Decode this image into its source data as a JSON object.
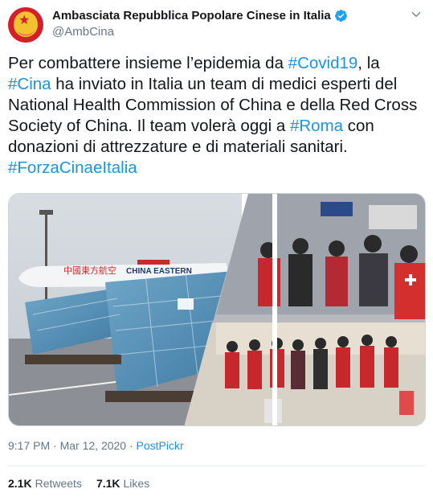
{
  "account": {
    "display_name": "Ambasciata Repubblica Popolare Cinese in Italia",
    "handle": "@AmbCina",
    "verified": true,
    "avatar_icon": "china-national-emblem"
  },
  "tweet": {
    "lines": [
      [
        {
          "t": "Per combattere insieme l’epidemia da "
        },
        {
          "t": "#Covid19",
          "tag": true
        },
        {
          "t": ", la"
        }
      ],
      [
        {
          "t": "#Cina",
          "tag": true
        },
        {
          "t": " ha inviato in Italia un team di medici esperti del"
        }
      ],
      [
        {
          "t": "National Health Commission of China e della Red Cross"
        }
      ],
      [
        {
          "t": "Society of China. Il team volerà oggi a "
        },
        {
          "t": "#Roma",
          "tag": true
        },
        {
          "t": " con"
        }
      ],
      [
        {
          "t": "donazioni di attrezzature e di materiali sanitari."
        }
      ],
      [
        {
          "t": "#ForzaCinaeItalia",
          "tag": true
        }
      ]
    ]
  },
  "media": {
    "airline_text": "CHINA EASTERN",
    "airline_chinese": "中國東方航空"
  },
  "meta": {
    "time": "9:17 PM",
    "separator": " · ",
    "date": "Mar 12, 2020",
    "source": "PostPickr"
  },
  "stats": {
    "retweets_count": "2.1K",
    "retweets_label": "Retweets",
    "likes_count": "7.1K",
    "likes_label": "Likes"
  },
  "colors": {
    "link": "#1b95e0",
    "secondary_text": "#657786",
    "verified_badge": "#1da1f2"
  }
}
